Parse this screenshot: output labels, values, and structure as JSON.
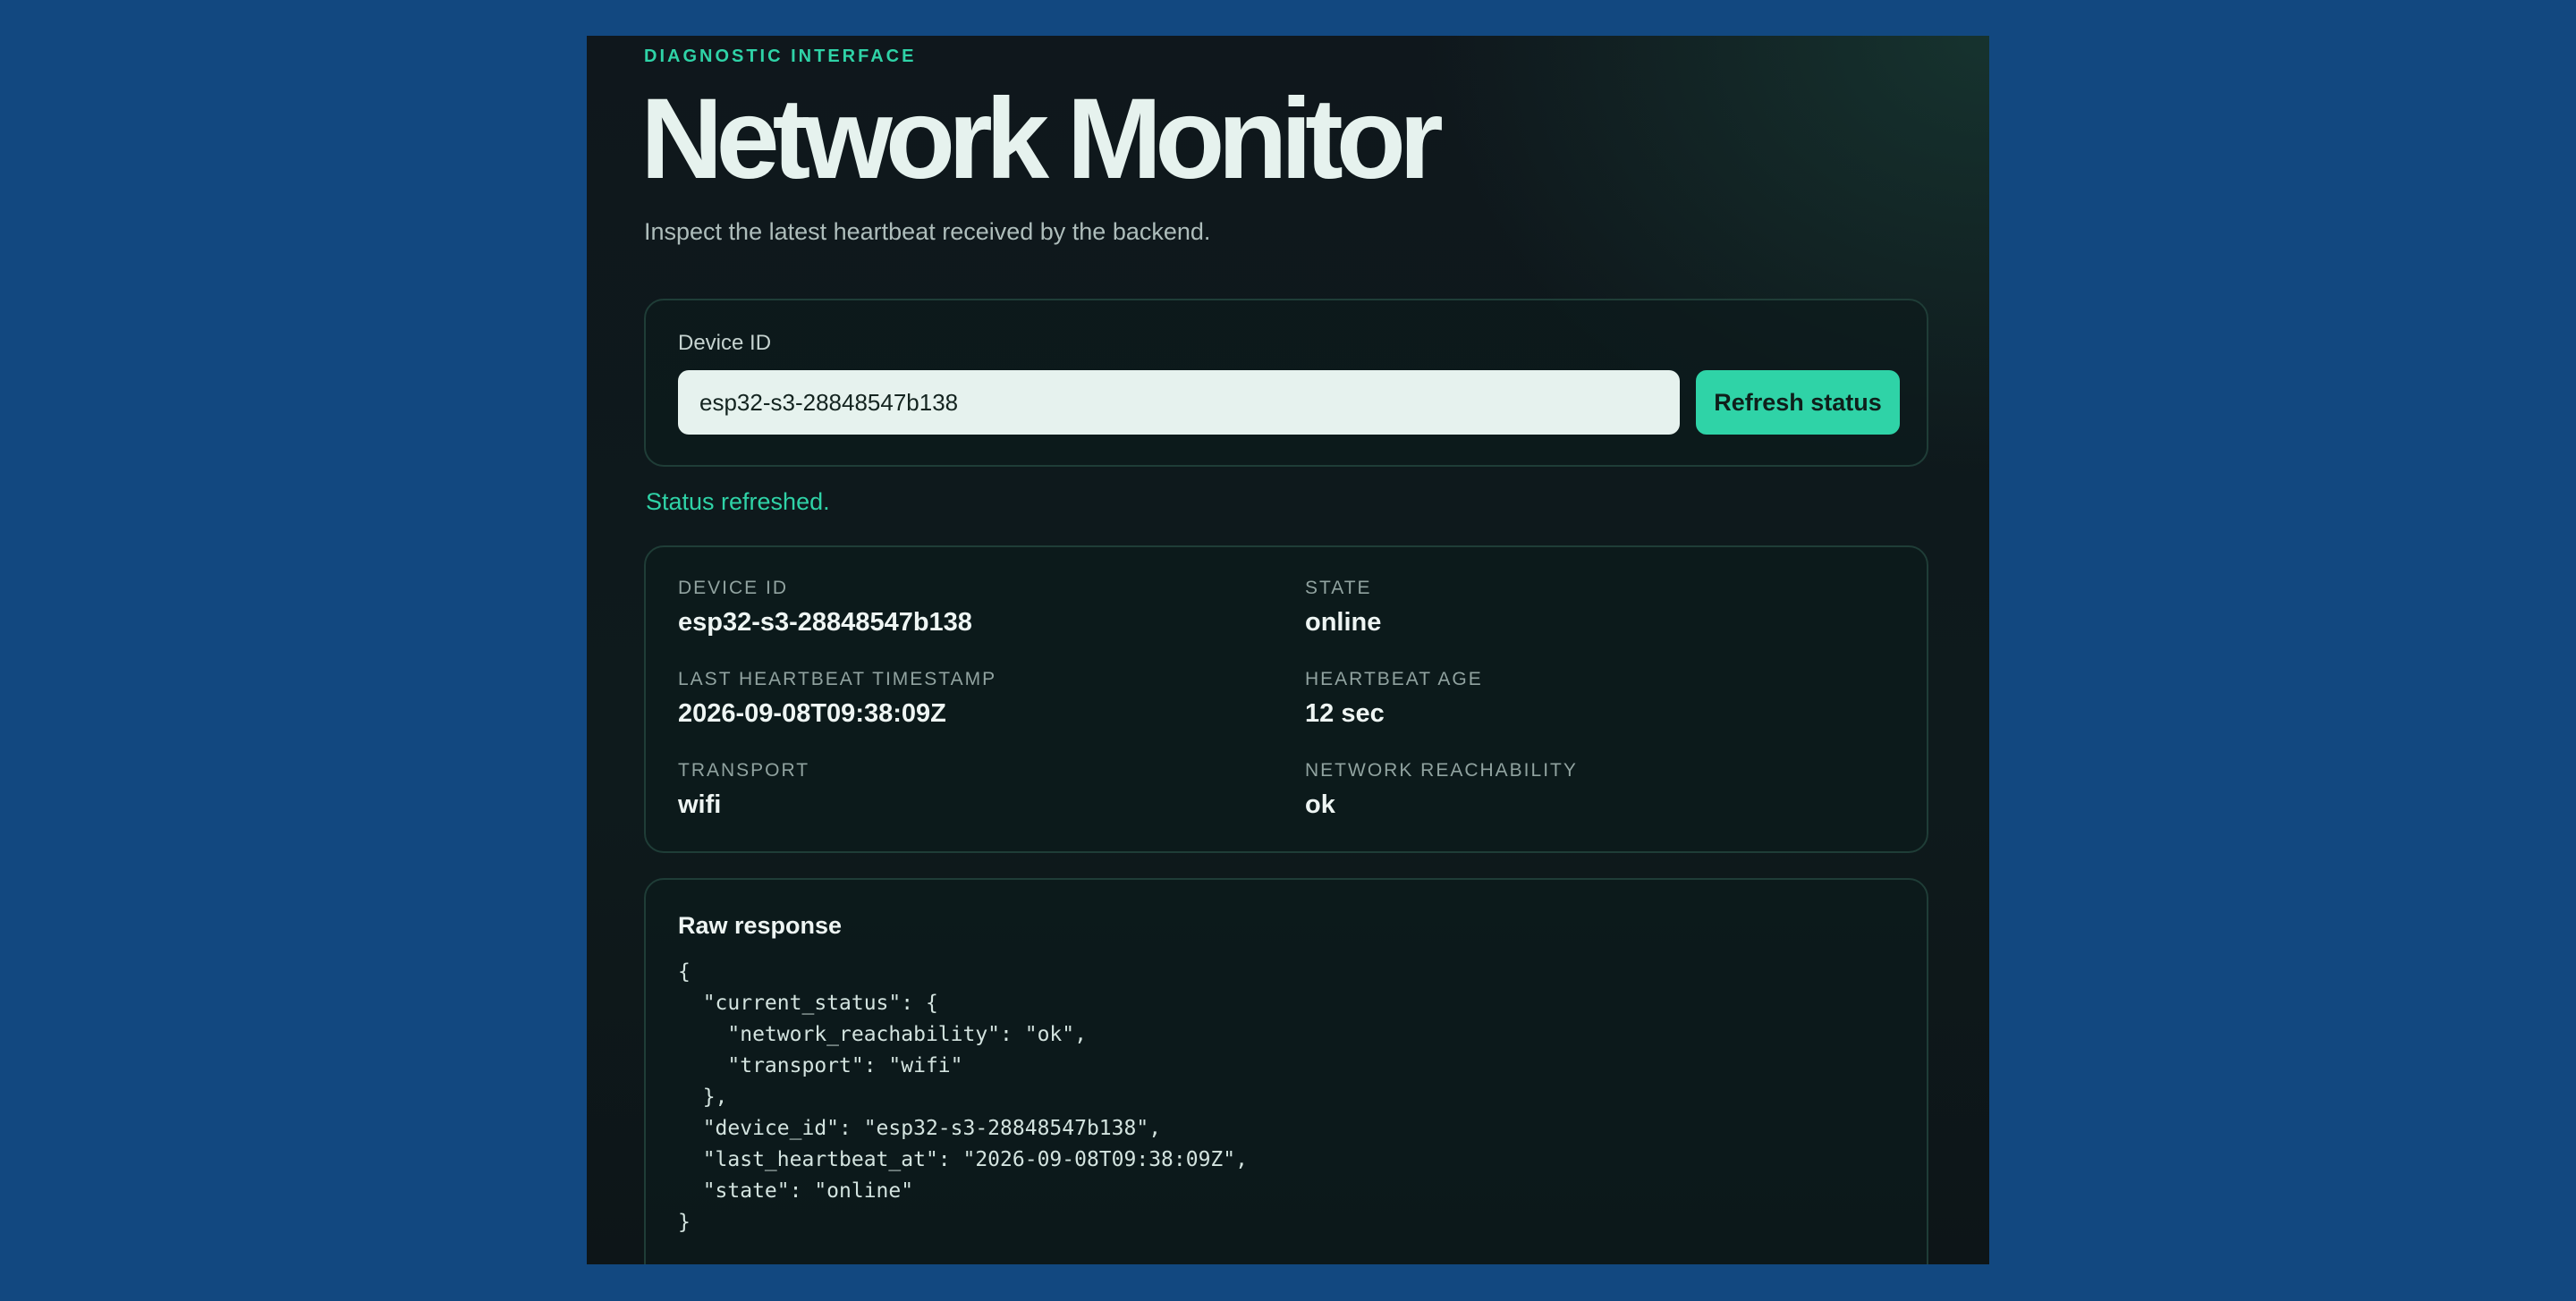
{
  "header": {
    "eyebrow": "DIAGNOSTIC INTERFACE",
    "title": "Network Monitor",
    "subtitle": "Inspect the latest heartbeat received by the backend."
  },
  "lookup": {
    "label": "Device ID",
    "value": "esp32-s3-28848547b138",
    "button_label": "Refresh status"
  },
  "status_message": "Status refreshed.",
  "details": {
    "device_id": {
      "label": "DEVICE ID",
      "value": "esp32-s3-28848547b138"
    },
    "state": {
      "label": "STATE",
      "value": "online"
    },
    "last_heartbeat": {
      "label": "LAST HEARTBEAT TIMESTAMP",
      "value": "2026-09-08T09:38:09Z"
    },
    "heartbeat_age": {
      "label": "HEARTBEAT AGE",
      "value": "12 sec"
    },
    "transport": {
      "label": "TRANSPORT",
      "value": "wifi"
    },
    "reachability": {
      "label": "NETWORK REACHABILITY",
      "value": "ok"
    }
  },
  "raw_response": {
    "title": "Raw response",
    "body": "{\n  \"current_status\": {\n    \"network_reachability\": \"ok\",\n    \"transport\": \"wifi\"\n  },\n  \"device_id\": \"esp32-s3-28848547b138\",\n  \"last_heartbeat_at\": \"2026-09-08T09:38:09Z\",\n  \"state\": \"online\"\n}"
  },
  "colors": {
    "background": "#124880",
    "accent": "#2fd3a7",
    "panel": "#0e1a1c",
    "input": "#e6f2ee"
  }
}
